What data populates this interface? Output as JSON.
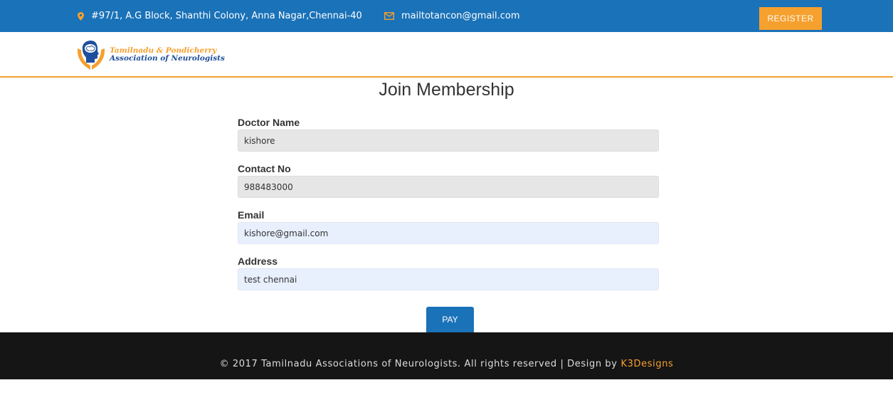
{
  "topbar": {
    "address": "#97/1, A.G Block, Shanthi Colony, Anna Nagar,Chennai-40",
    "email": "mailtotancon@gmail.com",
    "register_label": "REGISTER",
    "address_icon": "map-pin-icon",
    "email_icon": "envelope-icon"
  },
  "logo": {
    "line1": "Tamilnadu & Pondicherry",
    "line2": "Association of Neurologists"
  },
  "page": {
    "title": "Join Membership"
  },
  "form": {
    "doctor_name": {
      "label": "Doctor Name",
      "value": "kishore"
    },
    "contact_no": {
      "label": "Contact No",
      "value": "988483000"
    },
    "email": {
      "label": "Email",
      "value": "kishore@gmail.com"
    },
    "address": {
      "label": "Address",
      "value": "test chennai"
    },
    "pay_label": "PAY"
  },
  "footer": {
    "text": "© 2017 Tamilnadu Associations of Neurologists. All rights reserved | Design by",
    "designer": "K3Designs"
  },
  "colors": {
    "primary": "#1a72b8",
    "accent": "#f6a02d",
    "footer_bg": "#151515"
  }
}
